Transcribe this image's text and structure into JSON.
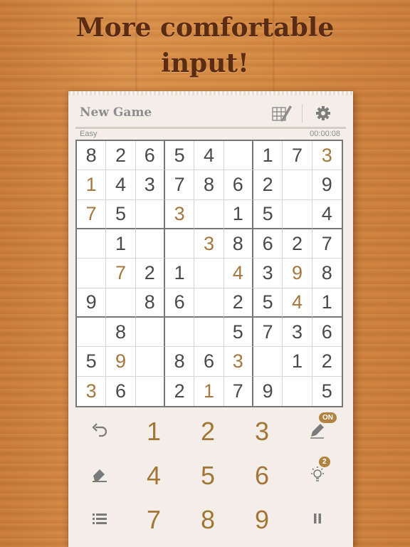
{
  "headline": {
    "line1": "More comfortable",
    "line2": "input!"
  },
  "header": {
    "title": "New Game"
  },
  "info": {
    "difficulty": "Easy",
    "timer": "00:00:08"
  },
  "colors": {
    "given": "#4a4a4a",
    "user_entry": "#a4783f",
    "accent": "#b2823f"
  },
  "icons": [
    "grid-pencil-icon",
    "gear-icon",
    "undo-icon",
    "eraser-icon",
    "menu-list-icon",
    "pencil-icon",
    "hint-bulb-icon",
    "pause-icon"
  ],
  "board": {
    "rows": [
      [
        "8",
        "2",
        "6",
        "5",
        "4",
        "",
        "1",
        "7",
        "3"
      ],
      [
        "1",
        "4",
        "3",
        "7",
        "8",
        "6",
        "2",
        "",
        "9"
      ],
      [
        "7",
        "5",
        "",
        "3",
        "",
        "1",
        "5",
        "",
        "4"
      ],
      [
        "",
        "1",
        "",
        "",
        "3",
        "8",
        "6",
        "2",
        "7"
      ],
      [
        "",
        "7",
        "2",
        "1",
        "",
        "4",
        "3",
        "9",
        "8"
      ],
      [
        "9",
        "",
        "8",
        "6",
        "",
        "2",
        "5",
        "4",
        "1"
      ],
      [
        "",
        "8",
        "",
        "",
        "",
        "5",
        "7",
        "3",
        "6"
      ],
      [
        "5",
        "9",
        "",
        "8",
        "6",
        "3",
        "",
        "1",
        "2"
      ],
      [
        "3",
        "6",
        "",
        "2",
        "1",
        "7",
        "9",
        "",
        "5"
      ]
    ],
    "user_entries": [
      [
        0,
        8
      ],
      [
        1,
        0
      ],
      [
        2,
        0
      ],
      [
        2,
        3
      ],
      [
        3,
        4
      ],
      [
        4,
        1
      ],
      [
        4,
        5
      ],
      [
        4,
        7
      ],
      [
        5,
        7
      ],
      [
        7,
        1
      ],
      [
        7,
        5
      ],
      [
        8,
        0
      ],
      [
        8,
        4
      ]
    ]
  },
  "keypad": {
    "numbers": [
      "1",
      "2",
      "3",
      "4",
      "5",
      "6",
      "7",
      "8",
      "9"
    ],
    "notes_badge": "ON",
    "hint_badge": "2"
  }
}
